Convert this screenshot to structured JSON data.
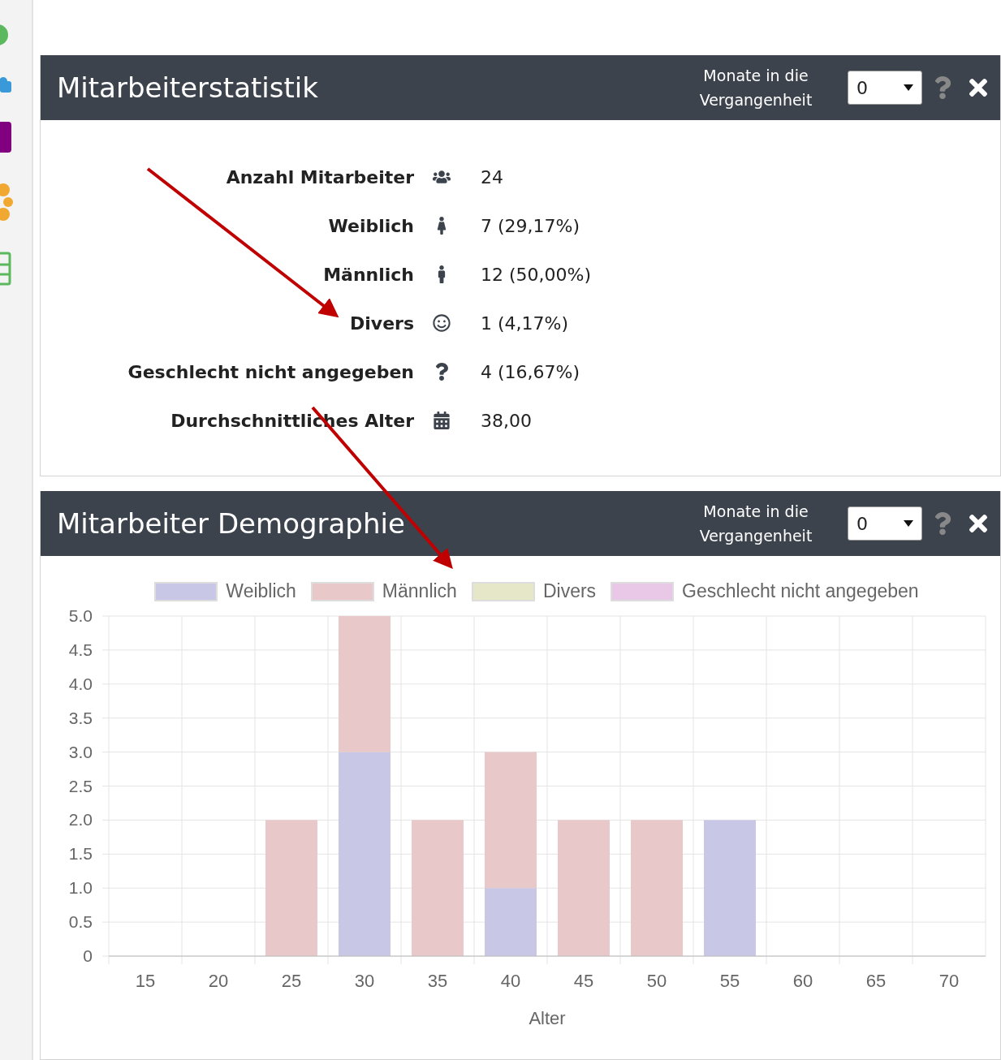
{
  "stats_panel": {
    "title": "Mitarbeiterstatistik",
    "months_label": "Monate in die Vergangenheit",
    "months_value": "0",
    "rows": [
      {
        "kind": "total",
        "label": "Anzahl Mitarbeiter",
        "value": "24"
      },
      {
        "kind": "female",
        "label": "Weiblich",
        "value": "7 (29,17%)"
      },
      {
        "kind": "male",
        "label": "Männlich",
        "value": "12 (50,00%)"
      },
      {
        "kind": "diverse",
        "label": "Divers",
        "value": "1 (4,17%)"
      },
      {
        "kind": "unknown",
        "label": "Geschlecht nicht angegeben",
        "value": "4 (16,67%)"
      },
      {
        "kind": "age",
        "label": "Durchschnittliches Alter",
        "value": "38,00"
      }
    ]
  },
  "demographics_panel": {
    "title": "Mitarbeiter Demographie",
    "months_label": "Monate in die Vergangenheit",
    "months_value": "0",
    "chart_data": {
      "type": "bar",
      "stacked": true,
      "grid": true,
      "xlabel": "Alter",
      "categories": [
        "15",
        "20",
        "25",
        "30",
        "35",
        "40",
        "45",
        "50",
        "55",
        "60",
        "65",
        "70"
      ],
      "ylim": [
        0,
        5
      ],
      "yticks": [
        {
          "value": 0,
          "label": "0"
        },
        {
          "value": 0.5,
          "label": "0.5"
        },
        {
          "value": 1,
          "label": "1.0"
        },
        {
          "value": 1.5,
          "label": "1.5"
        },
        {
          "value": 2,
          "label": "2.0"
        },
        {
          "value": 2.5,
          "label": "2.5"
        },
        {
          "value": 3,
          "label": "3.0"
        },
        {
          "value": 3.5,
          "label": "3.5"
        },
        {
          "value": 4,
          "label": "4.0"
        },
        {
          "value": 4.5,
          "label": "4.5"
        },
        {
          "value": 5,
          "label": "5.0"
        }
      ],
      "series": [
        {
          "name": "Weiblich",
          "color": "#c8c8e6",
          "values": [
            0,
            0,
            0,
            3,
            0,
            1,
            0,
            0,
            2,
            0,
            0,
            0
          ]
        },
        {
          "name": "Männlich",
          "color": "#e8c8c8",
          "values": [
            0,
            0,
            2,
            2,
            2,
            2,
            2,
            2,
            0,
            0,
            0,
            0
          ]
        },
        {
          "name": "Divers",
          "color": "#e6e6c8",
          "values": [
            0,
            0,
            0,
            0,
            0,
            0,
            0,
            0,
            0,
            0,
            0,
            0
          ]
        },
        {
          "name": "Geschlecht nicht angegeben",
          "color": "#e8c8e6",
          "values": [
            0,
            0,
            0,
            0,
            0,
            0,
            0,
            0,
            0,
            0,
            0,
            0
          ]
        }
      ]
    }
  }
}
